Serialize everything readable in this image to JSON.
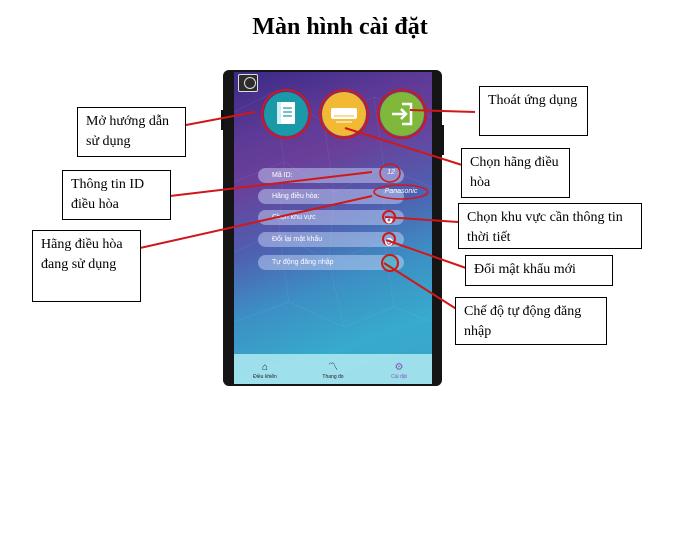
{
  "title": "Màn hình cài đặt",
  "app": {
    "icons": [
      "menu-icon",
      "book-icon",
      "air-conditioner-icon",
      "exit-icon",
      "location-icon",
      "refresh-icon",
      "home-icon",
      "chart-icon",
      "gear-icon"
    ],
    "rows": {
      "id_label": "Mã ID:",
      "id_value": "12",
      "brand_label": "Hãng điều hòa:",
      "brand_value": "Panasonic",
      "region_label": "Chọn khu vực",
      "password_label": "Đổi lại mật khẩu",
      "autologin_label": "Tự động đăng nhập"
    },
    "nav": {
      "control": "Điều khiển",
      "measure": "Thang đo",
      "settings": "Cài đặt"
    }
  },
  "callouts": {
    "guide": "Mở hướng dẫn sử dụng",
    "exit": "Thoát ứng dụng",
    "select_brand": "Chọn hãng điều hòa",
    "id_info": "Thông tin ID điều hòa",
    "current_brand": "Hãng điều hòa đang sử dụng",
    "region": "Chọn khu vực cần thông tin thời tiết",
    "password": "Đổi mật khẩu mới",
    "autologin": "Chế độ tự động đăng nhập"
  },
  "colors": {
    "book": "#1a9aa8",
    "air_conditioner": "#f2b935",
    "exit": "#7fb83a",
    "callout_line": "#d01818"
  }
}
